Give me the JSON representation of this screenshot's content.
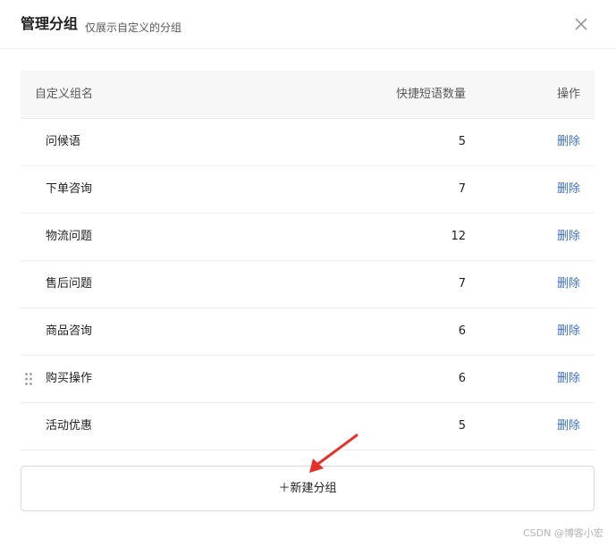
{
  "dialog": {
    "title": "管理分组",
    "subtitle": "仅展示自定义的分组",
    "close_icon": "close-icon"
  },
  "table": {
    "headers": {
      "name": "自定义组名",
      "count": "快捷短语数量",
      "operation": "操作"
    },
    "rows": [
      {
        "name": "问候语",
        "count": "5",
        "action": "删除"
      },
      {
        "name": "下单咨询",
        "count": "7",
        "action": "删除"
      },
      {
        "name": "物流问题",
        "count": "12",
        "action": "删除"
      },
      {
        "name": "售后问题",
        "count": "7",
        "action": "删除"
      },
      {
        "name": "商品咨询",
        "count": "6",
        "action": "删除"
      },
      {
        "name": "购买操作",
        "count": "6",
        "action": "删除"
      },
      {
        "name": "活动优惠",
        "count": "5",
        "action": "删除"
      }
    ]
  },
  "add_button": {
    "label": "＋新建分组"
  },
  "annotation": {
    "arrow_color": "#e8302a"
  },
  "watermark": {
    "text": "CSDN @博客小宏"
  },
  "colors": {
    "link": "#3b6fd6",
    "header_bg": "#f7f7f7",
    "border": "#ededed"
  }
}
